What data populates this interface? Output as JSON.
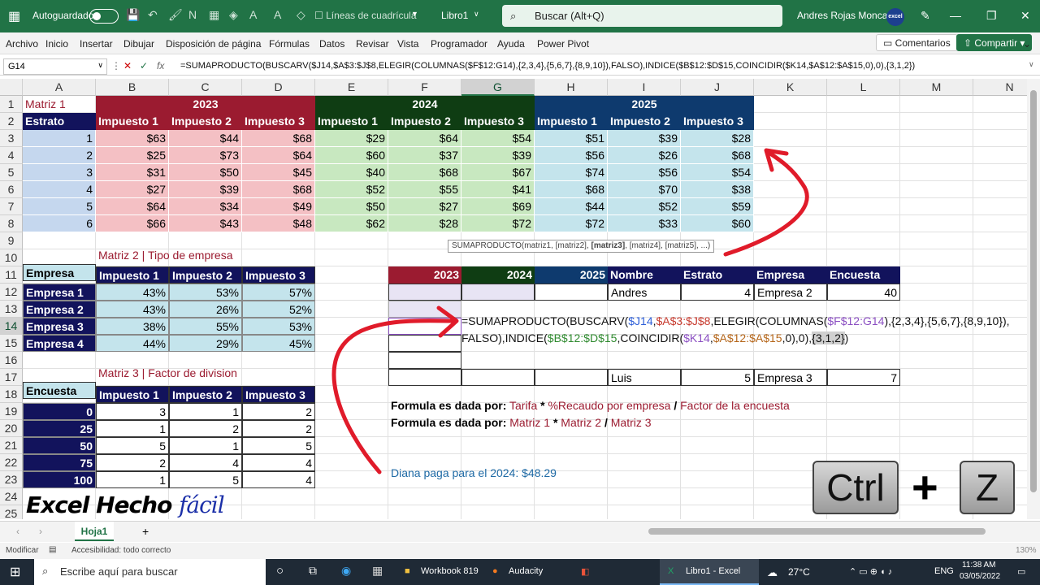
{
  "title_bar": {
    "autosave": "Autoguardado",
    "gridlines": "Líneas de cuadrícula",
    "workbook": "Libro1",
    "search": "Buscar (Alt+Q)",
    "user": "Andres Rojas Moncada",
    "avatar": "excel"
  },
  "ribbon": {
    "tabs": [
      "Archivo",
      "Inicio",
      "Insertar",
      "Dibujar",
      "Disposición de página",
      "Fórmulas",
      "Datos",
      "Revisar",
      "Vista",
      "Programador",
      "Ayuda",
      "Power Pivot"
    ],
    "comments": "Comentarios",
    "share": "Compartir"
  },
  "formula_bar": {
    "name_box": "G14",
    "fx": "fx",
    "formula": "=SUMAPRODUCTO(BUSCARV($J14,$A$3:$J$8,ELEGIR(COLUMNAS($F$12:G14),{2,3,4},{5,6,7},{8,9,10}),FALSO),INDICE($B$12:$D$15,COINCIDIR($K14,$A$12:$A$15,0),0),{3,1,2})"
  },
  "columns": [
    "A",
    "B",
    "C",
    "D",
    "E",
    "F",
    "G",
    "H",
    "I",
    "J",
    "K",
    "L",
    "M",
    "N"
  ],
  "rows": [
    "1",
    "2",
    "3",
    "4",
    "5",
    "6",
    "7",
    "8",
    "9",
    "10",
    "11",
    "12",
    "13",
    "14",
    "15",
    "16",
    "17",
    "18",
    "19",
    "20",
    "21",
    "22",
    "23",
    "24",
    "25"
  ],
  "matrix1": {
    "label": "Matriz 1",
    "stratum": "Estrato",
    "years": [
      "2023",
      "2024",
      "2025"
    ],
    "taxes": [
      "Impuesto 1",
      "Impuesto 2",
      "Impuesto 3",
      "Impuesto 1",
      "Impuesto 2",
      "Impuesto 3",
      "Impuesto 1",
      "Impuesto 2",
      "Impuesto 3"
    ],
    "rows": [
      [
        "1",
        "$63",
        "$44",
        "$68",
        "$29",
        "$64",
        "$54",
        "$51",
        "$39",
        "$28"
      ],
      [
        "2",
        "$25",
        "$73",
        "$64",
        "$60",
        "$37",
        "$39",
        "$56",
        "$26",
        "$68"
      ],
      [
        "3",
        "$31",
        "$50",
        "$45",
        "$40",
        "$68",
        "$67",
        "$74",
        "$56",
        "$54"
      ],
      [
        "4",
        "$27",
        "$39",
        "$68",
        "$52",
        "$55",
        "$41",
        "$68",
        "$70",
        "$38"
      ],
      [
        "5",
        "$64",
        "$34",
        "$49",
        "$50",
        "$27",
        "$69",
        "$44",
        "$52",
        "$59"
      ],
      [
        "6",
        "$66",
        "$43",
        "$48",
        "$62",
        "$28",
        "$72",
        "$72",
        "$33",
        "$60"
      ]
    ]
  },
  "matrix2": {
    "label": "Matriz 2 | Tipo de empresa",
    "company": "Empresa",
    "taxes": [
      "Impuesto 1",
      "Impuesto 2",
      "Impuesto 3"
    ],
    "rows": [
      [
        "Empresa 1",
        "43%",
        "53%",
        "57%"
      ],
      [
        "Empresa 2",
        "43%",
        "26%",
        "52%"
      ],
      [
        "Empresa 3",
        "38%",
        "55%",
        "53%"
      ],
      [
        "Empresa 4",
        "44%",
        "29%",
        "45%"
      ]
    ]
  },
  "matrix3": {
    "label": "Matriz 3 | Factor de division",
    "survey": "Encuesta",
    "taxes": [
      "Impuesto 1",
      "Impuesto 2",
      "Impuesto 3"
    ],
    "rows": [
      [
        "0",
        "3",
        "1",
        "2"
      ],
      [
        "25",
        "1",
        "2",
        "2"
      ],
      [
        "50",
        "5",
        "1",
        "5"
      ],
      [
        "75",
        "2",
        "4",
        "4"
      ],
      [
        "100",
        "1",
        "5",
        "4"
      ]
    ]
  },
  "result_table": {
    "headers": [
      "2023",
      "2024",
      "2025",
      "Nombre",
      "Estrato",
      "Empresa",
      "Encuesta"
    ],
    "row1": {
      "name": "Andres",
      "stratum": "4",
      "company": "Empresa 2",
      "survey": "40"
    },
    "row2": {
      "name": "Luis",
      "stratum": "5",
      "company": "Empresa 3",
      "survey": "7"
    }
  },
  "tooltip": {
    "pre": "SUMAPRODUCTO(matriz1, [matriz2], ",
    "bold": "[matriz3]",
    "post": ", [matriz4], [matriz5], ...)"
  },
  "formula_edit": {
    "p1": "=SUMAPRODUCTO(BUSCARV(",
    "ref1": "$J14",
    ",": ",",
    "ref2": "$A$3:$J$8",
    "p2": ",ELEGIR(COLUMNAS(",
    "ref3": "$F$12:G14",
    "p3": "),{2,3,4},{5,6,7},{8,9,10}),",
    "p4": "FALSO),INDICE(",
    "ref4": "$B$12:$D$15",
    "p5": ",COINCIDIR(",
    "ref5": "$K14",
    "ref6": "$A$12:$A$15",
    "p6": ",0),0),",
    "ref7": "{3,1,2}",
    "p7": ")"
  },
  "notes": {
    "line1_bold": "Formula es dada por:",
    "line1_a": "Tarifa",
    "star": "*",
    "line1_b": "%Recaudo por empresa",
    "slash": "/",
    "line1_c": "Factor de la encuesta",
    "line2_bold": "Formula es dada por:",
    "line2_a": "Matriz 1",
    "line2_b": "Matriz 2",
    "line2_c": "Matriz 3",
    "diana": "Diana paga para el 2024: $48.29"
  },
  "brand": {
    "main": "Excel Hecho",
    "script": "fácil"
  },
  "keys": {
    "ctrl": "Ctrl",
    "plus": "+",
    "z": "Z"
  },
  "sheet": {
    "tab": "Hoja1",
    "add": "+"
  },
  "status": {
    "mode": "Modificar",
    "accessibility": "Accesibilidad: todo correcto",
    "zoom": "130%"
  },
  "taskbar": {
    "search": "Escribe aquí para buscar",
    "apps": [
      "Workbook 819",
      "Audacity",
      "Libro1 - Excel"
    ],
    "temp": "27°C",
    "lang": "ENG",
    "time": "11:38 AM",
    "date": "03/05/2022"
  },
  "colors": {
    "excel_green": "#217346",
    "y2023": "#9b1b30",
    "y2024": "#0f3d13",
    "y2025": "#0e3a6e",
    "red_fill": "#f4c0c4",
    "green_fill": "#c8e8c0",
    "teal_fill": "#c4e4ec",
    "navy": "#12135c",
    "strata_fill": "#c5d7ee",
    "arrow": "#e01b2a"
  }
}
